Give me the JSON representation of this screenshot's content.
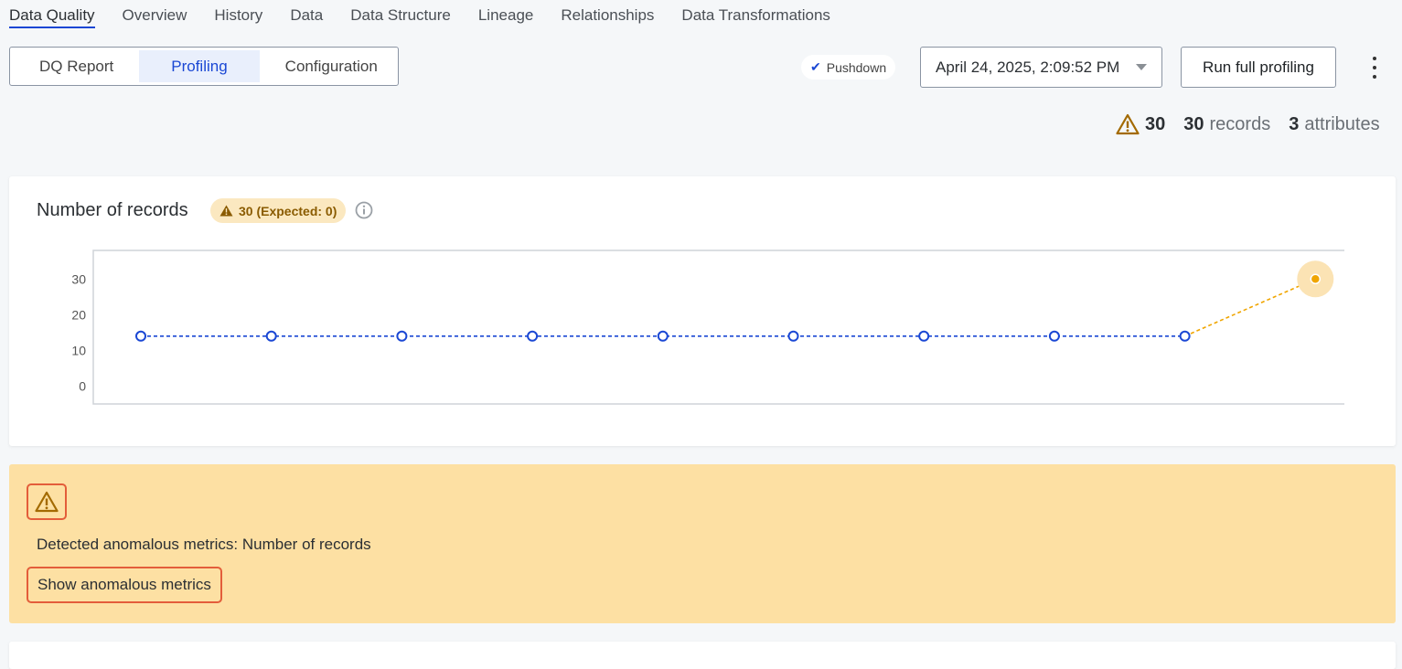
{
  "top_tabs": [
    "Data Quality",
    "Overview",
    "History",
    "Data",
    "Data Structure",
    "Lineage",
    "Relationships",
    "Data Transformations"
  ],
  "segments": [
    "DQ Report",
    "Profiling",
    "Configuration"
  ],
  "pushdown_label": "Pushdown",
  "date_value": "April 24, 2025, 2:09:52 PM",
  "run_button": "Run full profiling",
  "stats": {
    "warnings": "30",
    "records_count": "30",
    "records_label": "records",
    "attributes_count": "3",
    "attributes_label": "attributes"
  },
  "card": {
    "title": "Number of records",
    "badge": "30 (Expected: 0)"
  },
  "chart_data": {
    "type": "line",
    "title": "Number of records",
    "x": [
      1,
      2,
      3,
      4,
      5,
      6,
      7,
      8,
      9,
      10
    ],
    "series": [
      {
        "values": [
          14,
          14,
          14,
          14,
          14,
          14,
          14,
          14,
          14,
          30
        ],
        "color": "#1a47d4",
        "anomaly_color": "#f0a500"
      }
    ],
    "y_ticks": [
      "30",
      "20",
      "10",
      "0"
    ],
    "ylim": [
      -5,
      38
    ],
    "xlabel": "",
    "ylabel": ""
  },
  "alert": {
    "text": "Detected anomalous metrics: Number of records",
    "link": "Show anomalous metrics"
  },
  "colors": {
    "accent": "#1a47d4",
    "warning": "#f0a500",
    "alert_bg": "#fde0a3",
    "highlight": "#e35d3a"
  }
}
